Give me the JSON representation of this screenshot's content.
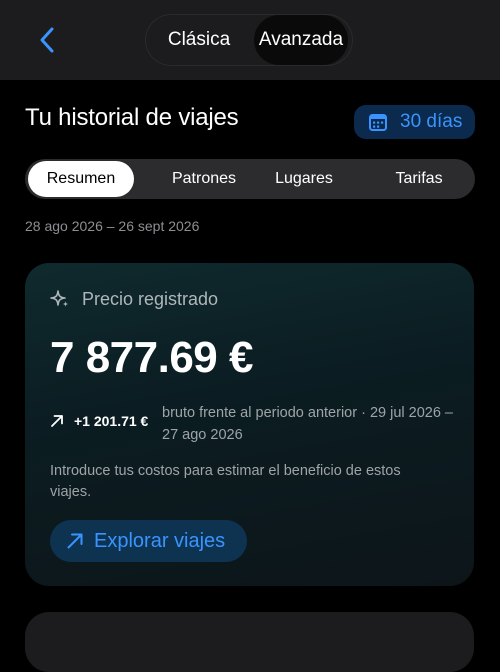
{
  "nav": {
    "modes": [
      "Clásica",
      "Avanzada"
    ],
    "selected_mode": "Avanzada",
    "back_icon": "chevron-left-icon"
  },
  "header": {
    "title": "Tu historial de viajes",
    "range_button": "30 días",
    "range_icon": "calendar-icon"
  },
  "tabs": [
    "Resumen",
    "Patrones",
    "Lugares",
    "Tarifas"
  ],
  "selected_tab": "Resumen",
  "date_range": "28 ago 2026 – 26 sept 2026",
  "summary_card": {
    "icon": "sparkles-icon",
    "label": "Precio registrado",
    "amount": "7 877.69 €",
    "delta_icon": "arrow-up-right-icon",
    "delta_value": "+1 201.71 €",
    "delta_desc": "bruto frente al periodo anterior · 29 jul 2026 – 27 ago 2026",
    "note": "Introduce tus costos para estimar el beneficio de estos viajes.",
    "explore_button": "Explorar viajes"
  },
  "colors": {
    "accent": "#3a94ff",
    "background": "#000000",
    "surface": "#1c1c1e"
  }
}
